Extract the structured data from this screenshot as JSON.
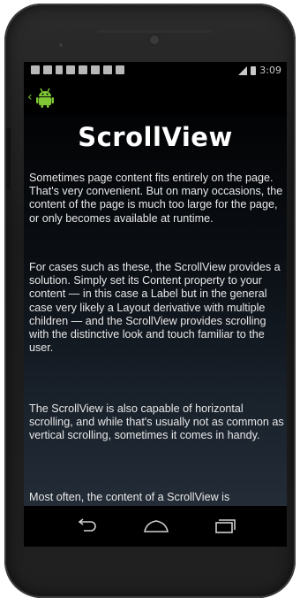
{
  "device": {
    "name": "android-phone"
  },
  "status_bar": {
    "time": "3:09",
    "notification_icons": [
      "notification-icon",
      "notification-icon",
      "download-icon",
      "mail-icon",
      "facebook-icon",
      "person-icon",
      "media-icon",
      "image-icon"
    ]
  },
  "action_bar": {
    "up_caret": "‹"
  },
  "page": {
    "title": "ScrollView",
    "paragraphs": [
      "Sometimes page content fits entirely on the page. That's very convenient. But on many occasions, the content of the page is much too large for the page, or only becomes available at runtime.",
      "For cases such as these, the ScrollView provides a solution. Simply set its Content property to your content — in this case a Label but in the general case very likely a Layout derivative with multiple children — and the ScrollView provides scrolling with the distinctive look and touch familiar to the user.",
      "The ScrollView is also capable of horizontal scrolling, and while that's usually not as common as vertical scrolling, sometimes it comes in handy.",
      "Most often, the content of a ScrollView is"
    ]
  },
  "navigation": {
    "buttons": [
      "back-icon",
      "home-icon",
      "recents-icon"
    ]
  },
  "colors": {
    "android_green": "#7ec634",
    "text": "#e8e8e8",
    "title": "#ffffff"
  }
}
